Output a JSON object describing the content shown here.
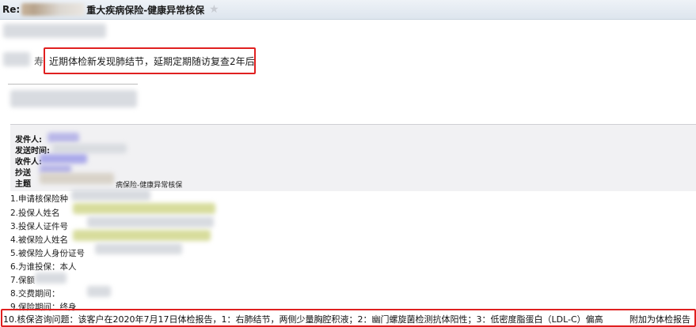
{
  "header": {
    "re_prefix": "Re:",
    "subject_text": "重大疾病保险-健康异常核保",
    "star_glyph": "★"
  },
  "message": {
    "visible_char": "寿",
    "highlighted_note": "近期体检新发现肺结节，延期定期随访复查2年后"
  },
  "forwarded_meta": {
    "labels": [
      "发件人:",
      "发送时间:",
      "收件人:",
      "抄送",
      "主题"
    ],
    "subject_tail": "病保险-健康异常核保"
  },
  "fields": [
    "1.申请核保险种",
    "2.投保人姓名",
    "3.投保人证件号",
    "4.被保险人姓名",
    "5.被保险人身份证号",
    "6.为谁投保：本人",
    "7.保额",
    "8.交费期间：",
    "9.保险期间：终身"
  ],
  "inquiry": {
    "label": "10.核保咨询问题：该客户在2020年7月17日体检报告，1：右肺结节，两侧少量胸腔积液；2：幽门螺旋菌检测抗体阳性；3：低密度脂蛋白（LDL-C）偏高",
    "attachment_note": "附加为体检报告"
  },
  "colors": {
    "highlight_border": "#e02020",
    "header_bg": "#dde5ee",
    "meta_panel_bg": "#f1f1f3"
  }
}
